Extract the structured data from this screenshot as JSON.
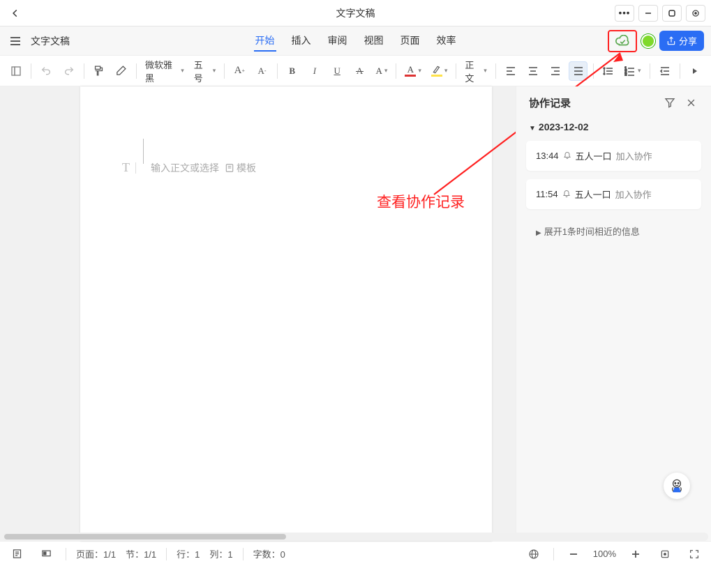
{
  "titlebar": {
    "title": "文字文稿"
  },
  "tabbar": {
    "doc_label": "文字文稿",
    "tabs": [
      "开始",
      "插入",
      "审阅",
      "视图",
      "页面",
      "效率"
    ],
    "active_index": 0,
    "share_label": "分享"
  },
  "toolbar": {
    "font_family": "微软雅黑",
    "font_size": "五号",
    "body_style": "正文"
  },
  "document": {
    "placeholder_before": "输入正文或选择",
    "template_label": "模板"
  },
  "annotation": {
    "text": "查看协作记录"
  },
  "sidepanel": {
    "title": "协作记录",
    "date": "2023-12-02",
    "entries": [
      {
        "time": "13:44",
        "user": "五人一口",
        "action": "加入协作"
      },
      {
        "time": "11:54",
        "user": "五人一口",
        "action": "加入协作"
      }
    ],
    "expand_label": "展开1条时间相近的信息"
  },
  "statusbar": {
    "page": "页面：1/1",
    "section": "节：1/1",
    "row": "行：1",
    "col": "列：1",
    "words": "字数：0",
    "zoom": "100%"
  }
}
